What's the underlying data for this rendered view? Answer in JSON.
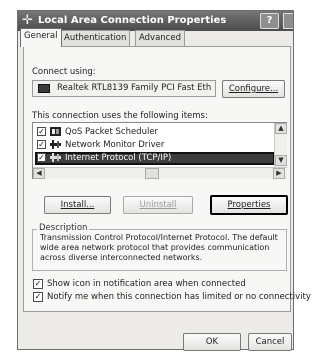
{
  "window": {
    "title": "Local Area Connection Properties",
    "help_label": "?"
  },
  "tabs": [
    {
      "label": "General",
      "active": true
    },
    {
      "label": "Authentication",
      "active": false
    },
    {
      "label": "Advanced",
      "active": false
    }
  ],
  "connect_using": {
    "label": "Connect using:",
    "adapter_name": "Realtek RTL8139 Family PCI Fast Eth",
    "configure_label": "Configure..."
  },
  "components": {
    "label": "This connection uses the following items:",
    "items": [
      {
        "label": "QoS Packet Scheduler",
        "checked": true,
        "icon": "scheduler-icon"
      },
      {
        "label": "Network Monitor Driver",
        "checked": true,
        "icon": "network-driver-icon"
      },
      {
        "label": "Internet Protocol (TCP/IP)",
        "checked": true,
        "icon": "protocol-icon",
        "selected": true
      }
    ]
  },
  "buttons": {
    "install": "Install...",
    "uninstall": "Uninstall",
    "properties": "Properties",
    "ok": "OK",
    "cancel": "Cancel"
  },
  "description": {
    "caption": "Description",
    "text": "Transmission Control Protocol/Internet Protocol. The default wide area network protocol that provides communication across diverse interconnected networks."
  },
  "options": [
    {
      "label": "Show icon in notification area when connected",
      "checked": true
    },
    {
      "label": "Notify me when this connection has limited or no connectivity",
      "checked": true
    }
  ],
  "colors": {
    "titlebar": "#4b4b4b",
    "dialog_bg": "#ecebe7",
    "selection": "#3d3d3d"
  }
}
